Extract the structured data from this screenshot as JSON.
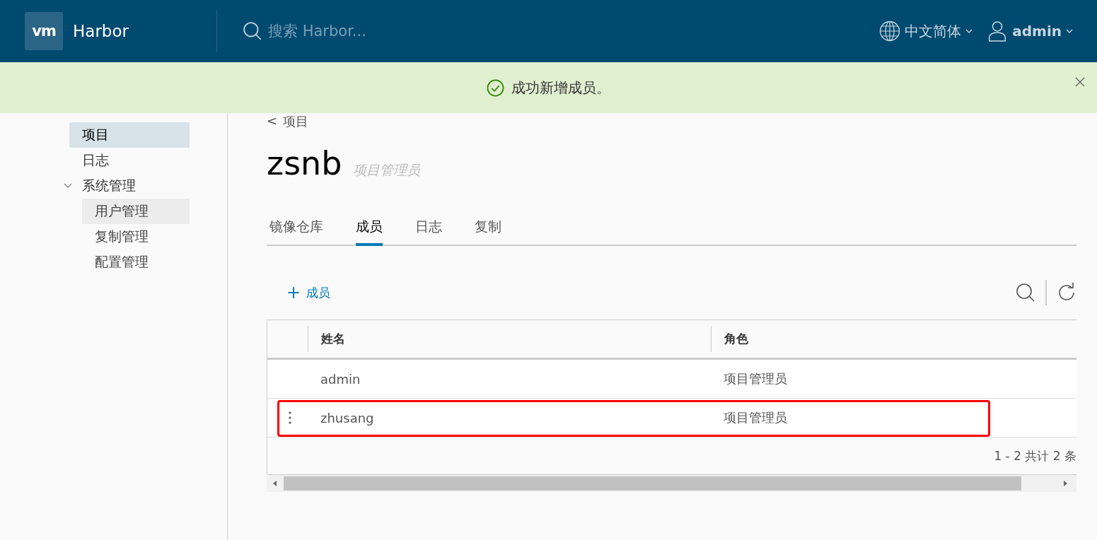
{
  "header": {
    "logo": "vm",
    "title": "Harbor",
    "search": {
      "placeholder": "搜索 Harbor..."
    },
    "language": "中文简体",
    "user": "admin"
  },
  "alert": {
    "message": "成功新增成员。"
  },
  "sidebar": {
    "items": [
      {
        "label": "项目",
        "selected": true
      },
      {
        "label": "日志",
        "selected": false
      },
      {
        "label": "系统管理",
        "expanded": true,
        "children": [
          {
            "label": "用户管理",
            "selected": true
          },
          {
            "label": "复制管理",
            "selected": false
          },
          {
            "label": "配置管理",
            "selected": false
          }
        ]
      }
    ]
  },
  "breadcrumb": {
    "arrow": "<",
    "label": "项目"
  },
  "project": {
    "name": "zsnb",
    "role": "项目管理员"
  },
  "tabs": [
    {
      "label": "镜像仓库",
      "selected": false
    },
    {
      "label": "成员",
      "selected": true
    },
    {
      "label": "日志",
      "selected": false
    },
    {
      "label": "复制",
      "selected": false
    }
  ],
  "add_button": {
    "icon": "+",
    "label": "成员"
  },
  "table": {
    "columns": [
      "姓名",
      "角色"
    ],
    "rows": [
      {
        "name": "admin",
        "role": "项目管理员",
        "actions_visible": false,
        "highlighted": false
      },
      {
        "name": "zhusang",
        "role": "项目管理员",
        "actions_visible": true,
        "highlighted": true
      }
    ],
    "footer": "1 - 2 共计 2 条"
  }
}
